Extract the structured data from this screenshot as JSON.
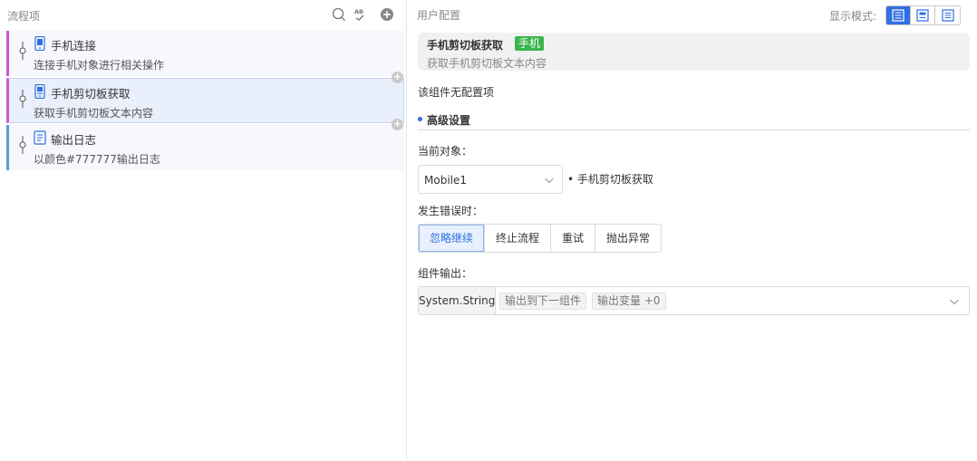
{
  "left_panel": {
    "title": "流程项",
    "icons": [
      "search-icon",
      "spellcheck-icon",
      "add-circle-icon"
    ],
    "items": [
      {
        "title": "手机连接",
        "desc": "连接手机对象进行相关操作",
        "icon": "mobile-connect-icon",
        "accent": "#c75ad6"
      },
      {
        "title": "手机剪切板获取",
        "desc": "获取手机剪切板文本内容",
        "icon": "mobile-clipboard-icon",
        "accent": "#c75ad6"
      },
      {
        "title": "输出日志",
        "desc": "以颜色#777777输出日志",
        "icon": "log-icon",
        "accent": "#5a9fd6"
      }
    ]
  },
  "right_panel": {
    "title": "用户配置",
    "display_mode_label": "显示模式:",
    "display_modes": [
      "mode-full-icon",
      "mode-compact-icon",
      "mode-list-icon"
    ],
    "active_mode": 0,
    "component": {
      "name": "手机剪切板获取",
      "badge": "手机",
      "desc": "获取手机剪切板文本内容"
    },
    "no_config_text": "该组件无配置项",
    "advanced_title": "高级设置",
    "current_object_label": "当前对象：",
    "current_object_value": "Mobile1",
    "current_object_note": "• 手机剪切板获取",
    "on_error_label": "发生错误时：",
    "on_error_options": [
      "忽略继续",
      "终止流程",
      "重试",
      "抛出异常"
    ],
    "on_error_selected": 0,
    "output_label": "组件输出：",
    "output_type": "System.String",
    "output_tags": [
      "输出到下一组件",
      "输出变量 +0"
    ]
  },
  "colors": {
    "accent": "#2f6fe0",
    "badge": "#3ab54a"
  }
}
